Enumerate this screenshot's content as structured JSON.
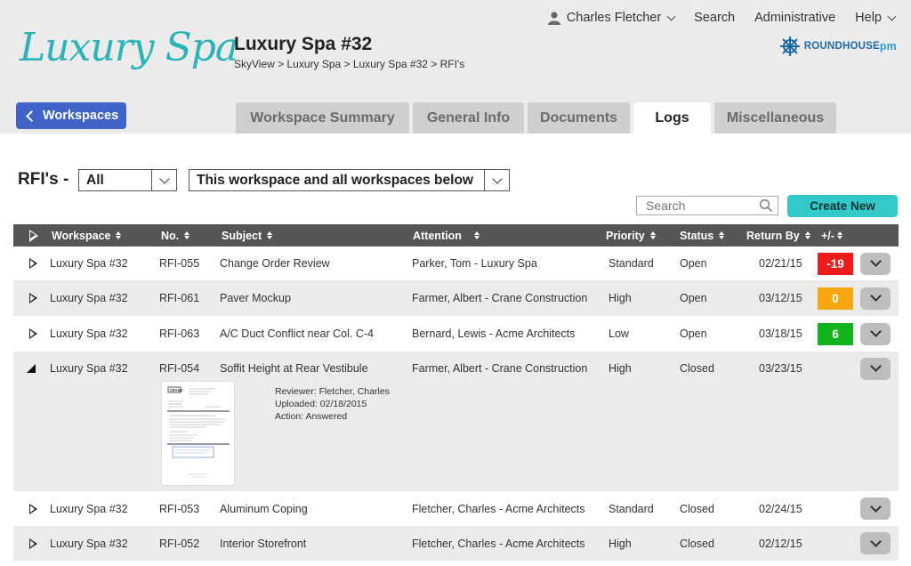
{
  "brand": {
    "logo_text": "Luxury Spa",
    "partner_logo": "ROUNDHOUSE",
    "partner_logo_suffix": "pm",
    "partner_icon": "ship-wheel-icon"
  },
  "header": {
    "title": "Luxury Spa #32",
    "breadcrumb": "SkyView > Luxury Spa > Luxury Spa #32 > RFI's"
  },
  "topnav": {
    "user": "Charles Fletcher",
    "search": "Search",
    "admin": "Administrative",
    "help": "Help"
  },
  "workspaces_button": "Workspaces",
  "tabs": [
    {
      "label": "Workspace Summary",
      "active": false
    },
    {
      "label": "General Info",
      "active": false
    },
    {
      "label": "Documents",
      "active": false
    },
    {
      "label": "Logs",
      "active": true
    },
    {
      "label": "Miscellaneous",
      "active": false
    }
  ],
  "filters": {
    "label": "RFI's -",
    "type_selected": "All",
    "scope_selected": "This workspace and all workspaces below"
  },
  "search": {
    "placeholder": "Search"
  },
  "create_button": "Create New",
  "columns": {
    "workspace": "Workspace",
    "no": "No.",
    "subject": "Subject",
    "attention": "Attention",
    "priority": "Priority",
    "status": "Status",
    "return_by": "Return By",
    "diff": "+/-"
  },
  "rows": [
    {
      "workspace": "Luxury Spa #32",
      "no": "RFI-055",
      "subject": "Change Order Review",
      "attention": "Parker, Tom - Luxury Spa",
      "priority": "Standard",
      "status": "Open",
      "return_by": "02/21/15",
      "diff": "-19",
      "diff_color": "#ee1c1c"
    },
    {
      "workspace": "Luxury Spa #32",
      "no": "RFI-061",
      "subject": "Paver Mockup",
      "attention": "Farmer, Albert - Crane Construction",
      "priority": "High",
      "status": "Open",
      "return_by": "03/12/15",
      "diff": "0",
      "diff_color": "#f7a70f"
    },
    {
      "workspace": "Luxury Spa #32",
      "no": "RFI-063",
      "subject": "A/C Duct Conflict near Col. C-4",
      "attention": "Bernard, Lewis - Acme Architects",
      "priority": "Low",
      "status": "Open",
      "return_by": "03/18/15",
      "diff": "6",
      "diff_color": "#11b41d"
    },
    {
      "workspace": "Luxury Spa #32",
      "no": "RFI-054",
      "subject": "Soffit Height at Rear Vestibule",
      "attention": "Farmer, Albert - Crane Construction",
      "priority": "High",
      "status": "Closed",
      "return_by": "03/23/15",
      "diff": "",
      "expanded": true,
      "detail": {
        "reviewer": "Reviewer: Fletcher, Charles",
        "uploaded": "Uploaded:  02/18/2015",
        "action": "Action:   Answered",
        "doc_brand": "CRANE"
      }
    },
    {
      "workspace": "Luxury Spa #32",
      "no": "RFI-053",
      "subject": "Aluminum Coping",
      "attention": "Fletcher, Charles - Acme Architects",
      "priority": "Standard",
      "status": "Closed",
      "return_by": "02/24/15",
      "diff": ""
    },
    {
      "workspace": "Luxury Spa #32",
      "no": "RFI-052",
      "subject": "Interior Storefront",
      "attention": "Fletcher, Charles - Acme Architects",
      "priority": "High",
      "status": "Closed",
      "return_by": "02/12/15",
      "diff": ""
    }
  ],
  "colors": {
    "accent_teal": "#33c8c9",
    "workspaces_blue": "#3f63c7",
    "header_bg": "#ebebeb",
    "table_header": "#555555"
  }
}
